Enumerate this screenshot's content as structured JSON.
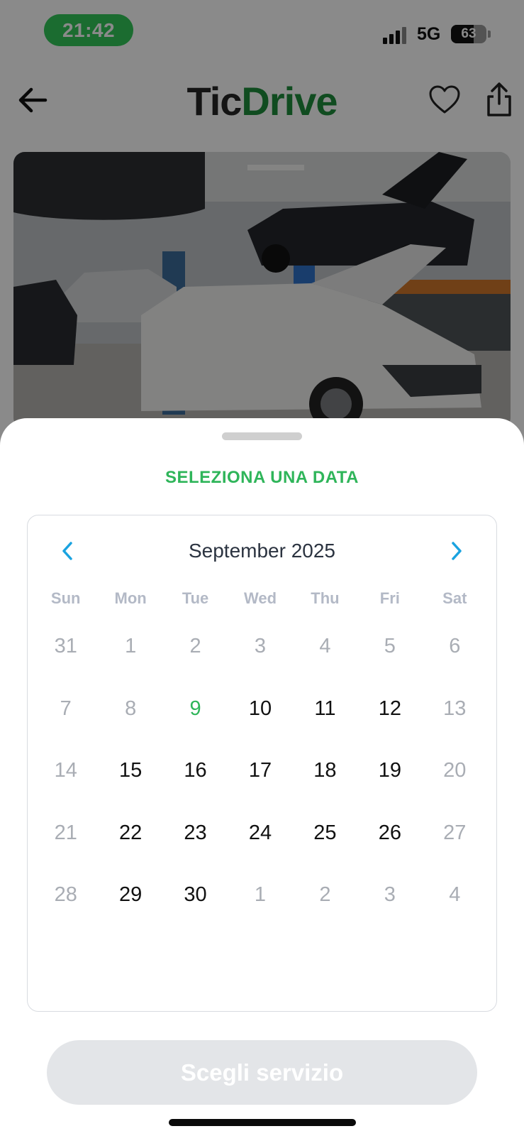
{
  "status_bar": {
    "time": "21:42",
    "network": "5G",
    "battery": "63",
    "battery_level": 0.63,
    "signal_bars_active": 3
  },
  "header": {
    "logo_part1": "Tic",
    "logo_part2": "Drive",
    "icons": [
      "arrow-left-icon",
      "heart-icon",
      "share-icon"
    ]
  },
  "sheet": {
    "title": "SELEZIONA UNA DATA",
    "calendar": {
      "month_label": "September 2025",
      "weekdays": [
        "Sun",
        "Mon",
        "Tue",
        "Wed",
        "Thu",
        "Fri",
        "Sat"
      ],
      "days": [
        {
          "label": "31",
          "state": "muted"
        },
        {
          "label": "1",
          "state": "muted"
        },
        {
          "label": "2",
          "state": "muted"
        },
        {
          "label": "3",
          "state": "muted"
        },
        {
          "label": "4",
          "state": "muted"
        },
        {
          "label": "5",
          "state": "muted"
        },
        {
          "label": "6",
          "state": "muted"
        },
        {
          "label": "7",
          "state": "muted"
        },
        {
          "label": "8",
          "state": "muted"
        },
        {
          "label": "9",
          "state": "today"
        },
        {
          "label": "10",
          "state": "available"
        },
        {
          "label": "11",
          "state": "available"
        },
        {
          "label": "12",
          "state": "available"
        },
        {
          "label": "13",
          "state": "muted"
        },
        {
          "label": "14",
          "state": "muted"
        },
        {
          "label": "15",
          "state": "available"
        },
        {
          "label": "16",
          "state": "available"
        },
        {
          "label": "17",
          "state": "available"
        },
        {
          "label": "18",
          "state": "available"
        },
        {
          "label": "19",
          "state": "available"
        },
        {
          "label": "20",
          "state": "muted"
        },
        {
          "label": "21",
          "state": "muted"
        },
        {
          "label": "22",
          "state": "available"
        },
        {
          "label": "23",
          "state": "available"
        },
        {
          "label": "24",
          "state": "available"
        },
        {
          "label": "25",
          "state": "available"
        },
        {
          "label": "26",
          "state": "available"
        },
        {
          "label": "27",
          "state": "muted"
        },
        {
          "label": "28",
          "state": "muted"
        },
        {
          "label": "29",
          "state": "available"
        },
        {
          "label": "30",
          "state": "available"
        },
        {
          "label": "1",
          "state": "muted"
        },
        {
          "label": "2",
          "state": "muted"
        },
        {
          "label": "3",
          "state": "muted"
        },
        {
          "label": "4",
          "state": "muted"
        }
      ]
    },
    "cta_label": "Scegli servizio",
    "cta_enabled": false
  },
  "colors": {
    "brand_green": "#1f8c3b",
    "accent_green": "#2fb55a",
    "nav_arrow_blue": "#1aa3e0",
    "disabled_button": "#e3e5e8"
  }
}
